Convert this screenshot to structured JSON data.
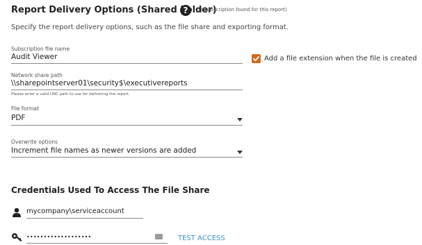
{
  "header": {
    "title": "Report Delivery Options (Shared Folder)",
    "subscription_count": "(1 subscription found for this report)",
    "description": "Specify the report delivery options, such as the file share and exporting format."
  },
  "fields": {
    "file_name": {
      "label": "Subscription file name",
      "value": "Audit Viewer"
    },
    "add_extension": {
      "checked": true,
      "label": "Add a file extension when the file is created",
      "color": "#d2691e"
    },
    "network_path": {
      "label": "Network share path",
      "value": "\\\\sharepointserver01\\security$\\executivereports",
      "hint": "Please enter a valid UNC path to use for delivering the report."
    },
    "file_format": {
      "label": "File format",
      "value": "PDF"
    },
    "overwrite": {
      "label": "Overwrite options",
      "value": "Increment file names as newer versions are added"
    }
  },
  "credentials": {
    "title": "Credentials Used To Access The File Share",
    "username": "mycompany\\serviceaccount",
    "password": "•••••••••••••••••••",
    "test_access_label": "TEST ACCESS",
    "link_color": "#3a8fc4"
  },
  "icons": {
    "help": "help-circle-icon",
    "checkbox": "check-icon",
    "user": "user-icon",
    "key": "key-icon",
    "keyboard": "keyboard-icon",
    "dropdown": "chevron-down-icon"
  }
}
